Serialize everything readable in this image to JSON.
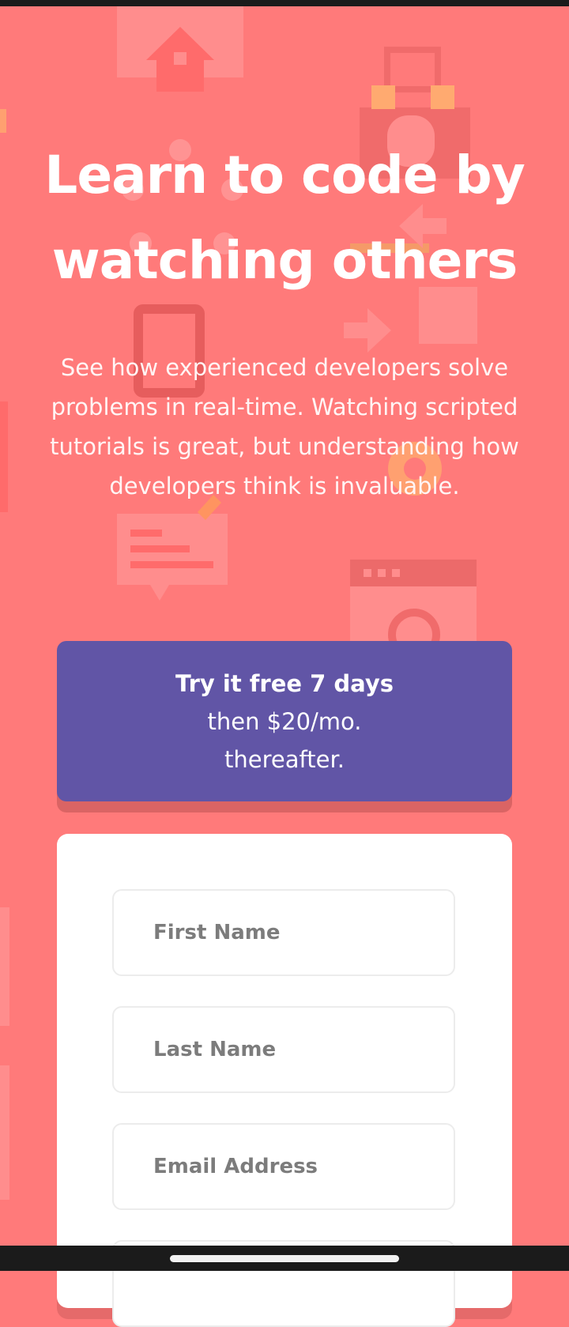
{
  "hero": {
    "title_line1": "Learn to code by",
    "title_line2": "watching others",
    "description": "See how experienced developers solve problems in real-time. Watching scripted tutorials is great, but understanding how developers think is invaluable."
  },
  "trial": {
    "headline": "Try it free 7 days",
    "detail_line1": "then $20/mo.",
    "detail_line2": "thereafter."
  },
  "form": {
    "first_name_placeholder": "First Name",
    "last_name_placeholder": "Last Name",
    "email_placeholder": "Email Address"
  },
  "colors": {
    "background": "#ff7a7a",
    "banner": "#6155a6",
    "card": "#ffffff",
    "text_light": "#ffffff"
  }
}
